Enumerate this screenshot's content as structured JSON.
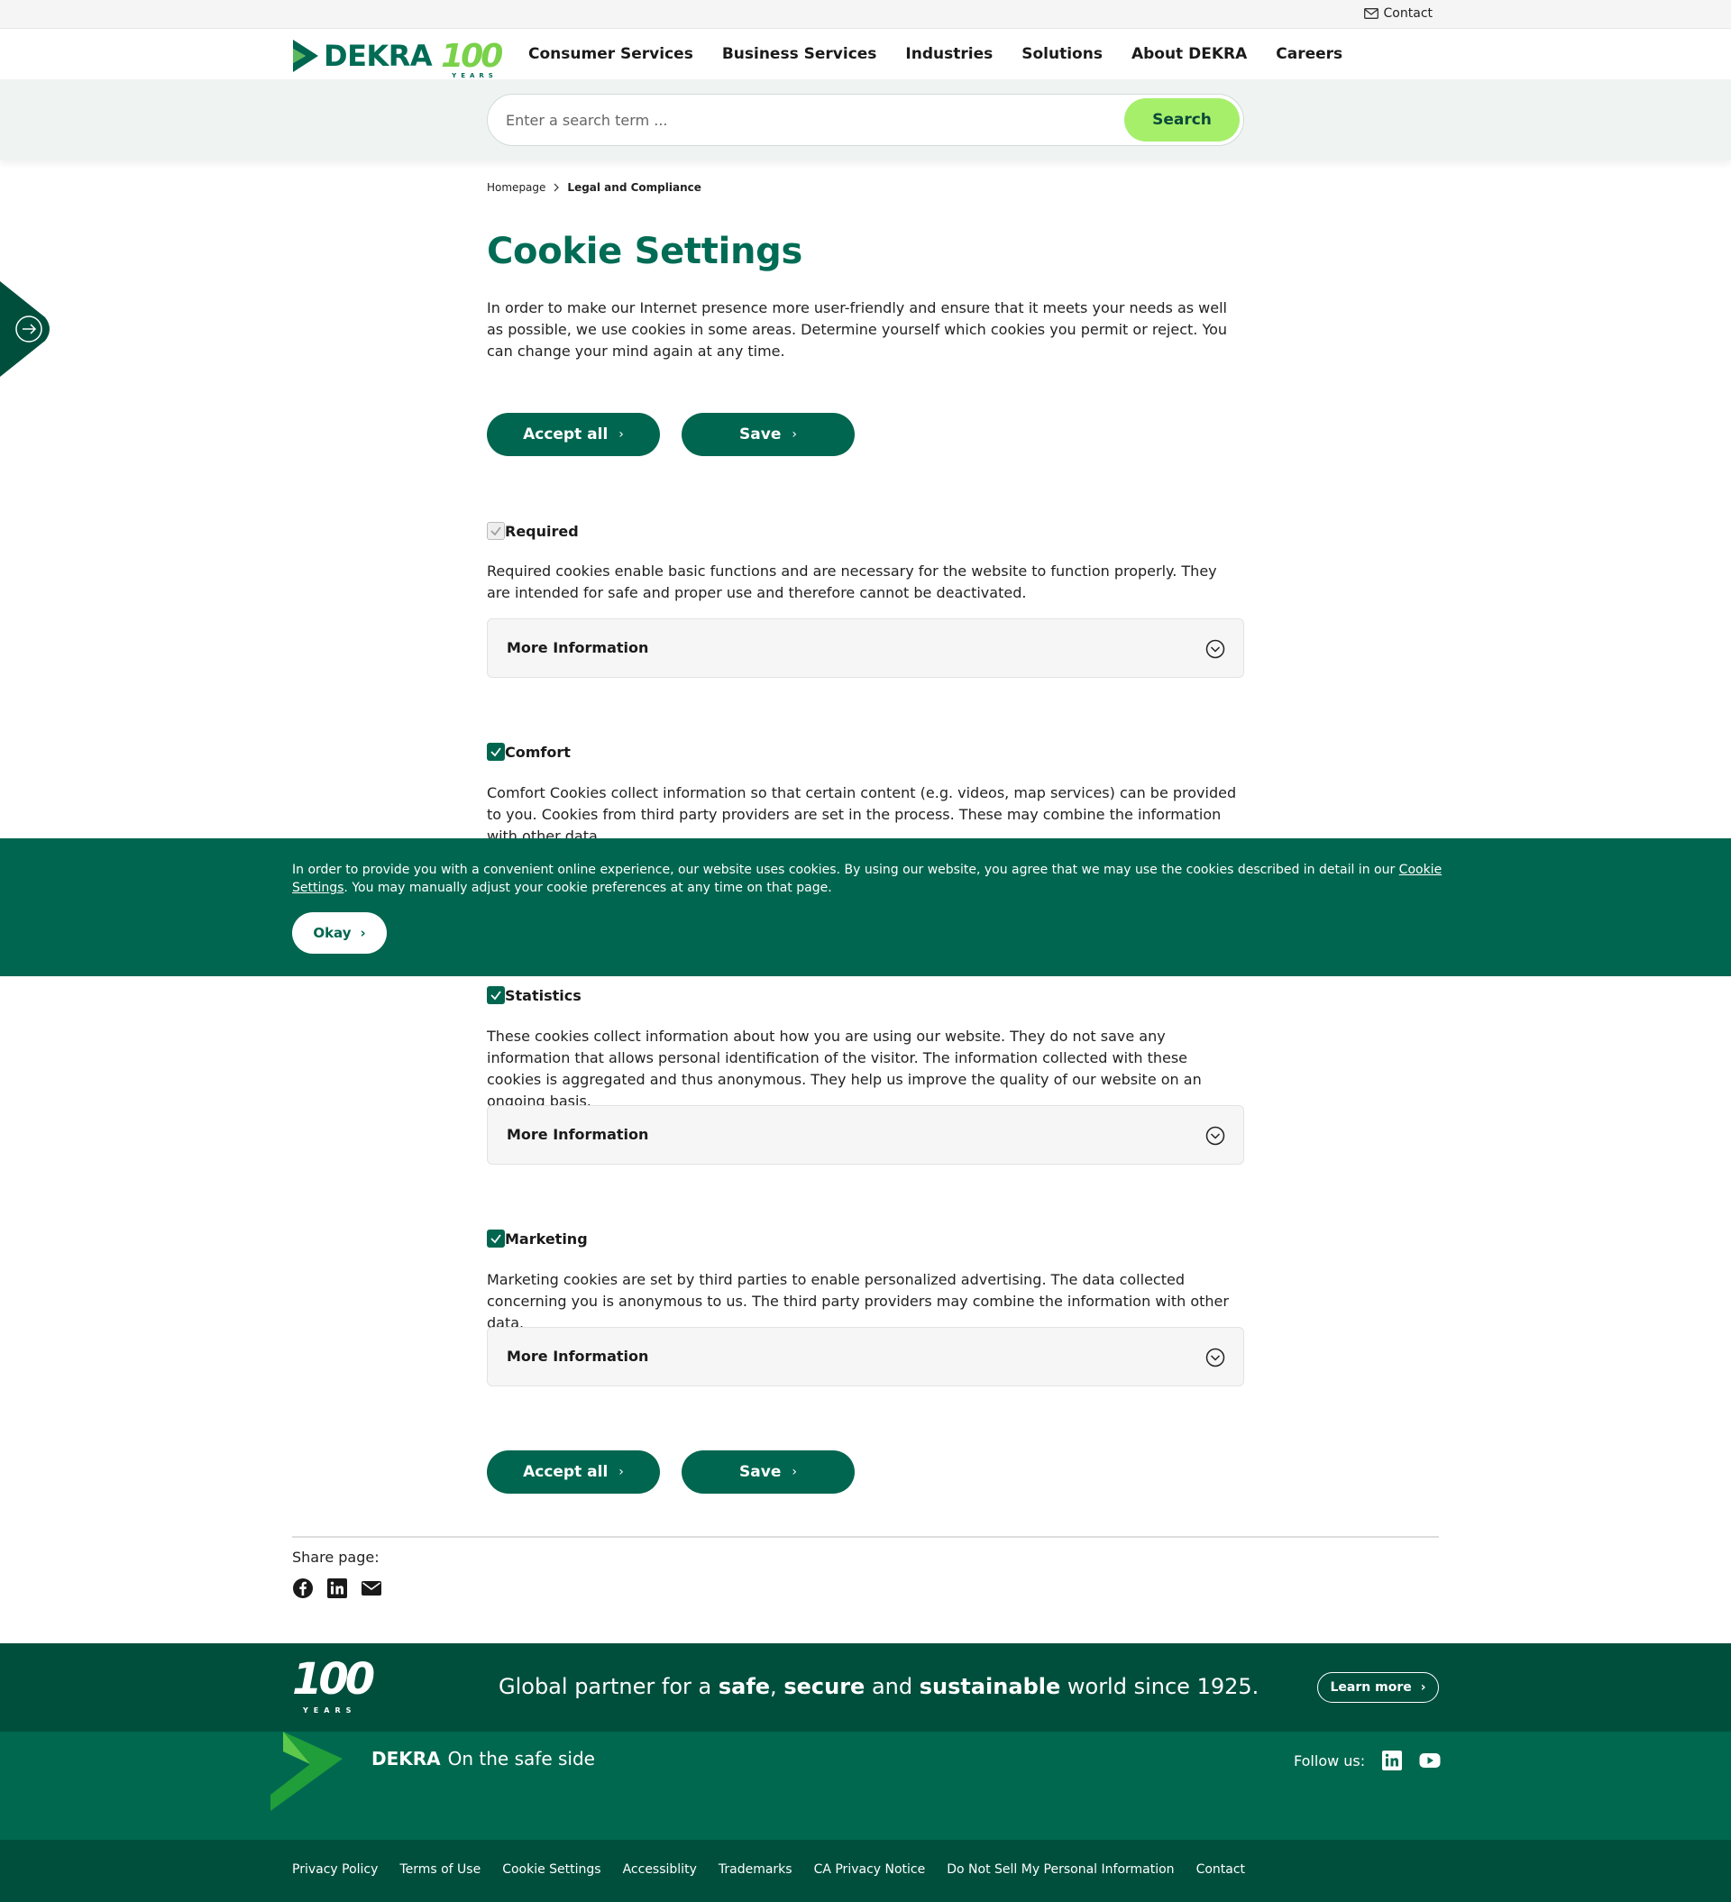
{
  "topbar": {
    "contact_label": "Contact"
  },
  "header": {
    "logo_text": "DEKRA",
    "logo_anniversary": "100",
    "logo_years": "YEARS",
    "nav": [
      "Consumer Services",
      "Business Services",
      "Industries",
      "Solutions",
      "About DEKRA",
      "Careers"
    ]
  },
  "search": {
    "placeholder": "Enter a search term ...",
    "button_label": "Search"
  },
  "breadcrumb": {
    "home": "Homepage",
    "current": "Legal and Compliance"
  },
  "page": {
    "title": "Cookie Settings",
    "intro": "In order to make our Internet presence more user-friendly and ensure that it meets your needs as well as possible, we use cookies in some areas. Determine yourself which cookies you permit or reject. You can change your mind again at any time.",
    "accept_all_label": "Accept all",
    "save_label": "Save",
    "more_info_label": "More Information"
  },
  "sections": [
    {
      "name": "Required",
      "checked": true,
      "disabled": true,
      "description": "Required cookies enable basic functions and are necessary for the website to function properly. They are intended for safe and proper use and therefore cannot be deactivated."
    },
    {
      "name": "Comfort",
      "checked": true,
      "disabled": false,
      "description": "Comfort Cookies collect information so that certain content (e.g. videos, map services) can be provided to you. Cookies from third party providers are set in the process. These may combine the information with other data."
    },
    {
      "name": "Statistics",
      "checked": true,
      "disabled": false,
      "description": "These cookies collect information about how you are using our website. They do not save any information that allows personal identification of the visitor. The information collected with these cookies is aggregated and thus anonymous. They help us improve the quality of our website on an ongoing basis."
    },
    {
      "name": "Marketing",
      "checked": true,
      "disabled": false,
      "description": "Marketing cookies are set by third parties to enable personalized advertising. The data collected concerning you is anonymous to us. The third party providers may combine the information with other data."
    }
  ],
  "banner": {
    "text_before": "In order to provide you with a convenient online experience, our website uses cookies. By using our website, you agree that we may use the cookies described in detail in our ",
    "link_text": "Cookie Settings",
    "text_after": ". You may manually adjust your cookie preferences at any time on that page.",
    "okay_label": "Okay"
  },
  "share": {
    "label": "Share page:",
    "icons": [
      "facebook-icon",
      "linkedin-icon",
      "email-icon"
    ]
  },
  "footer": {
    "anniversary": "100",
    "anniversary_years": "YEARS",
    "tagline_parts": [
      "Global partner for a ",
      "safe",
      ", ",
      "secure",
      " and ",
      "sustainable",
      " world since 1925."
    ],
    "learn_more_label": "Learn more",
    "brand_name": "DEKRA",
    "brand_slogan": "On the safe side",
    "follow_label": "Follow us:",
    "links": [
      "Privacy Policy",
      "Terms of Use",
      "Cookie Settings",
      "Accessiblity",
      "Trademarks",
      "CA Privacy Notice",
      "Do Not Sell My Personal Information",
      "Contact"
    ]
  },
  "colors": {
    "brand_green": "#00664f",
    "dark_green": "#004f3d",
    "accent_lime": "#a6ef6a"
  }
}
